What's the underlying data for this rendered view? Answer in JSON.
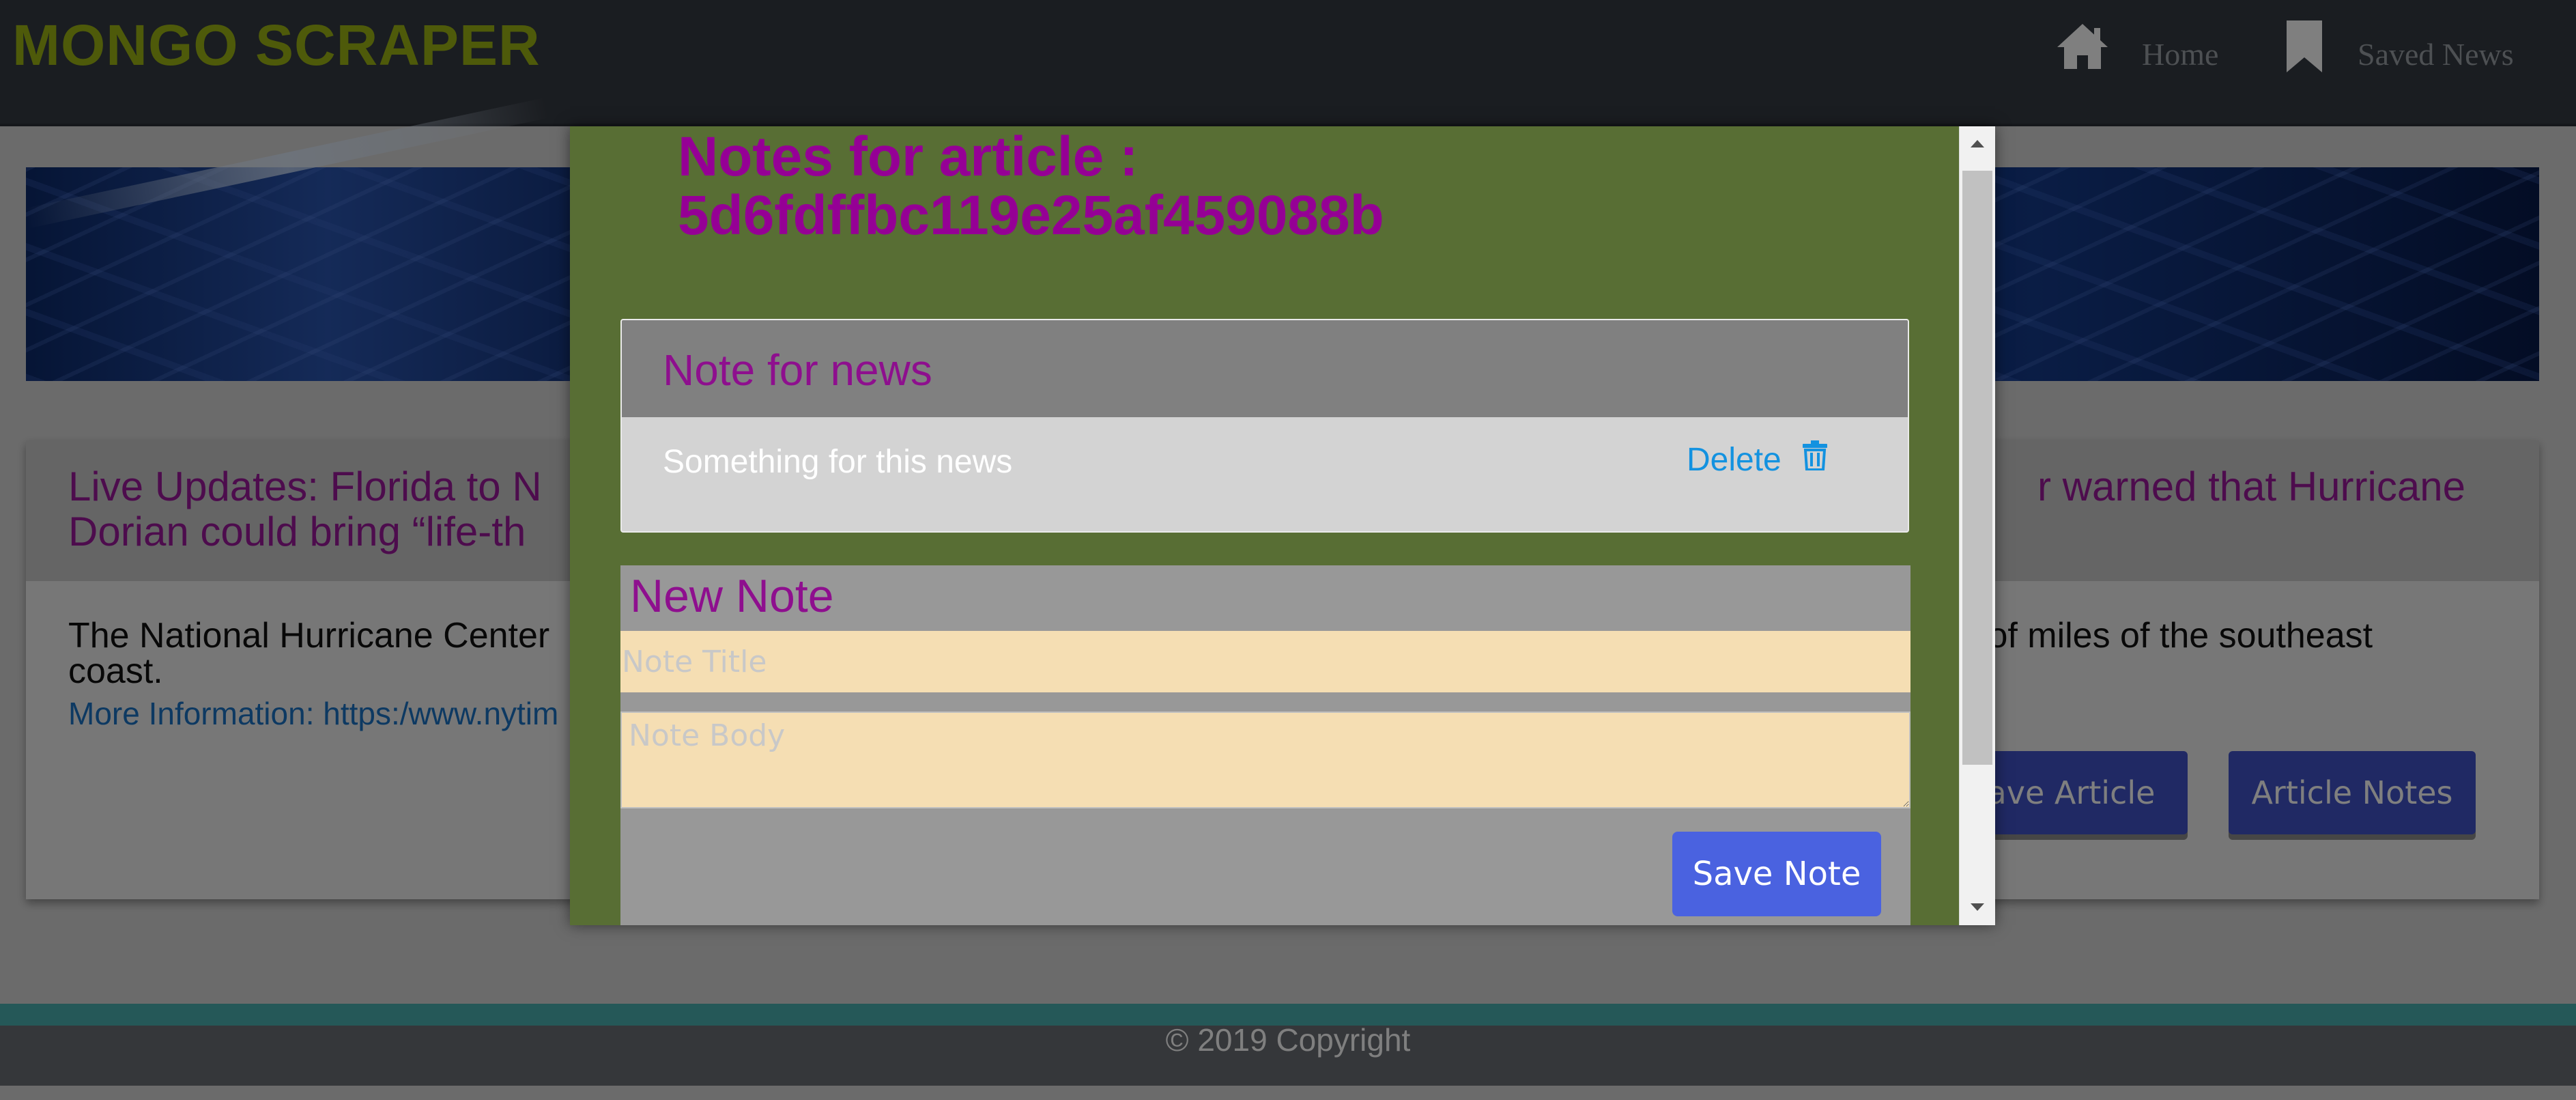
{
  "navbar": {
    "brand": "MONGO SCRAPER",
    "items": [
      {
        "label": "Home",
        "icon": "home-icon"
      },
      {
        "label": "Saved News",
        "icon": "bookmark-icon"
      }
    ]
  },
  "article": {
    "title": "Live Updates: Florida to N… warned that Hurricane Dorian could bring “life-th…",
    "title_left_line1": "Live Updates: Florida to N",
    "title_left_line2": "Dorian could bring “life-th",
    "title_right_line1": "r warned that Hurricane",
    "summary_left_line1": "The National Hurricane Center",
    "summary_left_line2": "coast.",
    "summary_right_line1": "s of miles of the southeast",
    "more_info": "More Information: https:/www.nytim",
    "unsave_button": "save Article",
    "notes_button": "Article Notes"
  },
  "modal": {
    "title_line1": "Notes for article :",
    "title_line2": "5d6fdffbc119e25af459088b",
    "note_card": {
      "heading": "Note for news",
      "text": "Something for this news",
      "delete_label": "Delete"
    },
    "new_note": {
      "heading": "New Note",
      "title_placeholder": "Note Title",
      "body_placeholder": "Note Body",
      "save_label": "Save Note"
    }
  },
  "footer": {
    "text": "© 2019 Copyright"
  },
  "colors": {
    "navbar_bg": "#353a42",
    "brand": "#9db414",
    "modal_bg": "#586e34",
    "heading_purple": "#950095",
    "input_bg": "#f5deb3",
    "button_blue": "#4a62e0",
    "link_blue": "#1392e0"
  }
}
